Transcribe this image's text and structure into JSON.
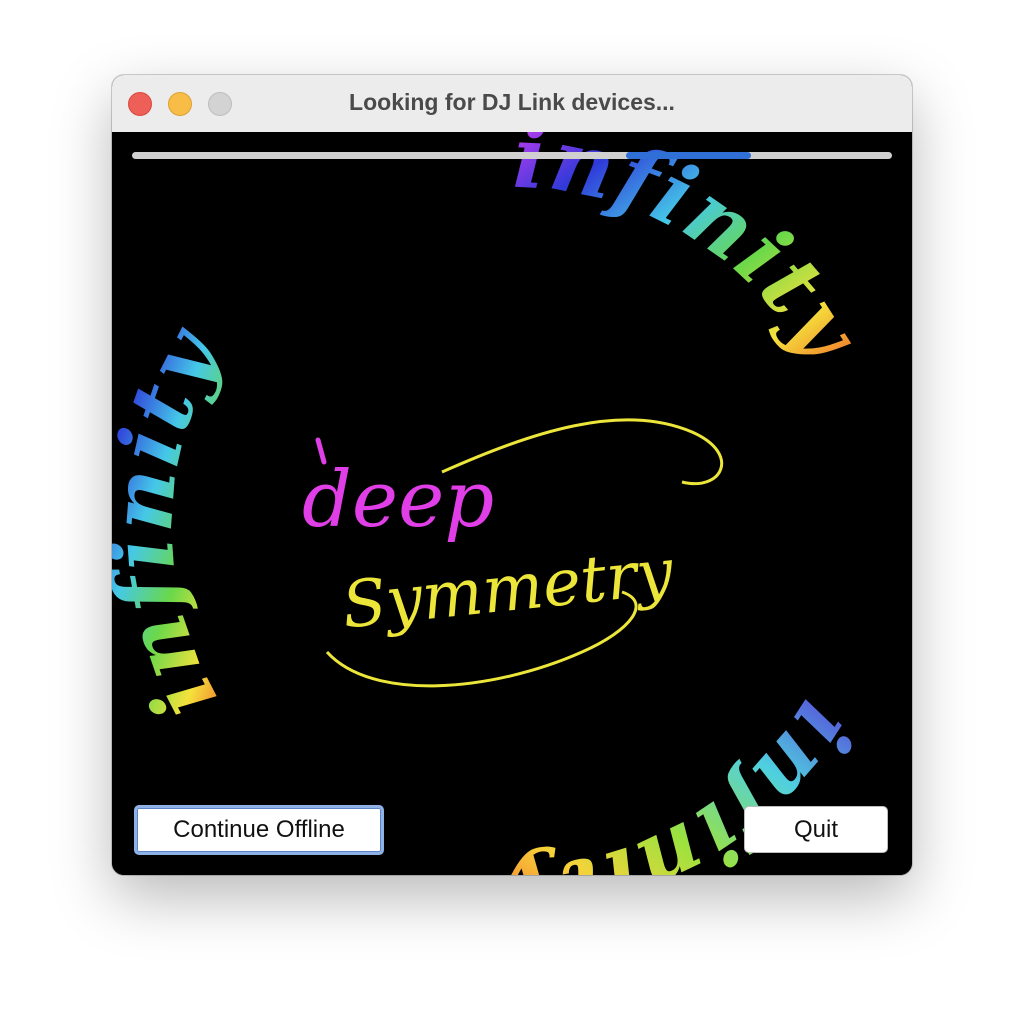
{
  "window": {
    "title": "Looking for DJ Link devices..."
  },
  "progress": {
    "indeterminate": true,
    "segment_start_fraction": 0.65,
    "segment_length_fraction": 0.165,
    "fill_color": "#2f6fd6",
    "track_color": "#d0d0d0"
  },
  "artwork": {
    "center_text_top": "deep",
    "center_text_bottom": "Symmetry",
    "ring_word": "infinity",
    "ring_style": "rainbow ambigram ring"
  },
  "buttons": {
    "continue_offline": "Continue Offline",
    "quit": "Quit"
  },
  "colors": {
    "close": "#ee5f57",
    "minimize": "#f7bd46",
    "zoom_disabled": "#d3d3d3",
    "focus_ring": "#8fb1e6"
  }
}
